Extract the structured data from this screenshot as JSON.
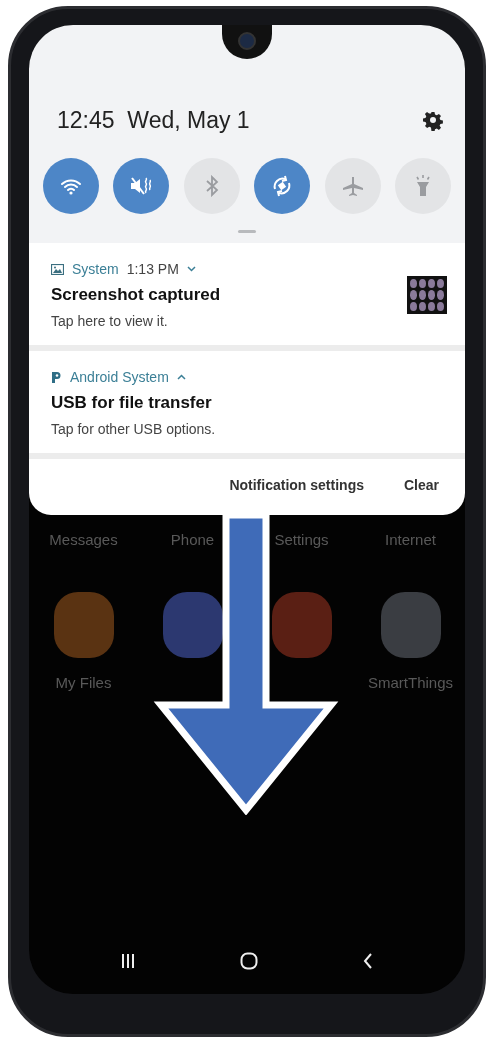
{
  "status": {
    "time": "12:45",
    "date": "Wed, May 1"
  },
  "quick_toggles": [
    {
      "kind": "wifi",
      "on": true
    },
    {
      "kind": "mute",
      "on": true
    },
    {
      "kind": "bluetooth",
      "on": false
    },
    {
      "kind": "rotate",
      "on": true
    },
    {
      "kind": "airplane",
      "on": false
    },
    {
      "kind": "flashlight",
      "on": false
    }
  ],
  "notifications": [
    {
      "kind": "gallery",
      "app": "System",
      "time": "1:13 PM",
      "expanded": false,
      "title": "Screenshot captured",
      "text": "Tap here to view it.",
      "thumbnail": true
    },
    {
      "kind": "android",
      "app": "Android System",
      "expanded": true,
      "title": "USB for file transfer",
      "text": "Tap for other USB options.",
      "thumbnail": false
    }
  ],
  "notification_actions": [
    "Notification settings",
    "Clear"
  ],
  "home_apps": [
    {
      "label": "Messages"
    },
    {
      "label": "Phone"
    },
    {
      "label": "Settings"
    },
    {
      "label": "Internet"
    },
    {
      "label": "My Files",
      "color": "#5a3312"
    },
    {
      "color": "#2c3870"
    },
    {
      "color": "#5a1f14"
    },
    {
      "label": "SmartThings",
      "color": "#3a3d42"
    }
  ]
}
